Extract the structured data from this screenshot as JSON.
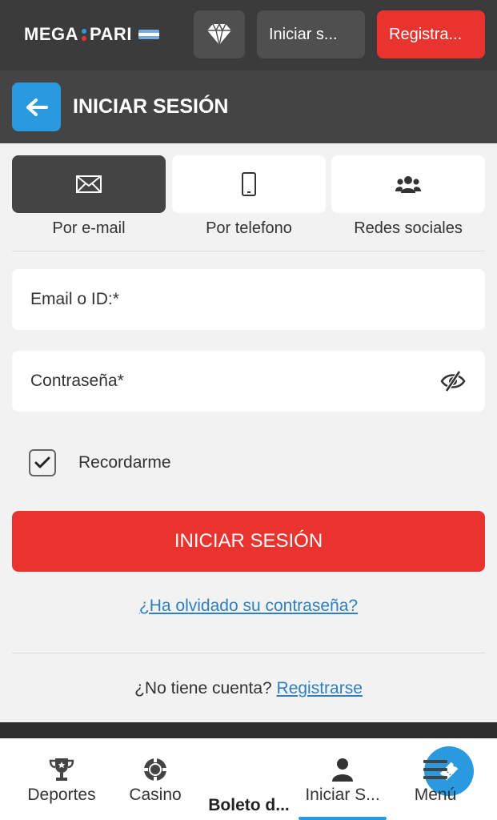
{
  "header": {
    "logo_left": "MEGA",
    "logo_right": "PARI",
    "login_label": "Iniciar s...",
    "register_label": "Registra..."
  },
  "page": {
    "title": "INICIAR SESIÓN"
  },
  "tabs": [
    {
      "label": "Por e-mail",
      "icon": "envelope-icon",
      "active": true
    },
    {
      "label": "Por telefono",
      "icon": "phone-icon",
      "active": false
    },
    {
      "label": "Redes sociales",
      "icon": "users-icon",
      "active": false
    }
  ],
  "form": {
    "email_placeholder": "Email o ID:*",
    "password_placeholder": "Contraseña*",
    "remember_label": "Recordarme",
    "remember_checked": true,
    "submit_label": "INICIAR SESIÓN",
    "forgot_label": "¿Ha olvidado su contraseña?",
    "no_account_text": "¿No tiene cuenta?",
    "register_link": "Registrarse"
  },
  "bottom_nav": [
    {
      "label": "Deportes",
      "icon": "trophy-icon"
    },
    {
      "label": "Casino",
      "icon": "casino-chip-icon"
    },
    {
      "label": "Boleto d...",
      "icon": "ticket-icon"
    },
    {
      "label": "Iniciar S...",
      "icon": "user-icon",
      "active": true
    },
    {
      "label": "Menú",
      "icon": "menu-icon"
    }
  ],
  "colors": {
    "accent_red": "#e8332e",
    "accent_blue": "#2a9ae0",
    "header_bg": "#3b3b3b",
    "link_blue": "#2f7fbf"
  }
}
